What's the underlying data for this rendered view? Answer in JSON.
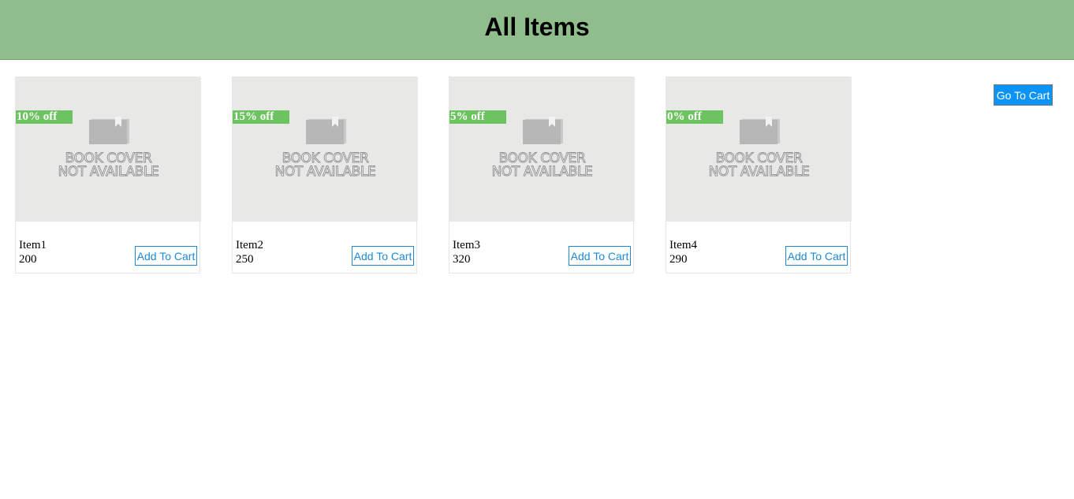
{
  "header": {
    "title": "All Items"
  },
  "cart_button_label": "Go To Cart",
  "cover_placeholder": {
    "line1": "BOOK COVER",
    "line2": "NOT AVAILABLE"
  },
  "products": [
    {
      "name": "Item1",
      "price": "200",
      "discount": "10% off",
      "button_label": "Add To Cart"
    },
    {
      "name": "Item2",
      "price": "250",
      "discount": "15% off",
      "button_label": "Add To Cart"
    },
    {
      "name": "Item3",
      "price": "320",
      "discount": "5% off",
      "button_label": "Add To Cart"
    },
    {
      "name": "Item4",
      "price": "290",
      "discount": "0% off",
      "button_label": "Add To Cart"
    }
  ],
  "colors": {
    "header_bg": "#8fbd8c",
    "discount_badge": "#6cc35f",
    "cart_button": "#0b93f6",
    "add_button_accent": "#1e88d4"
  }
}
